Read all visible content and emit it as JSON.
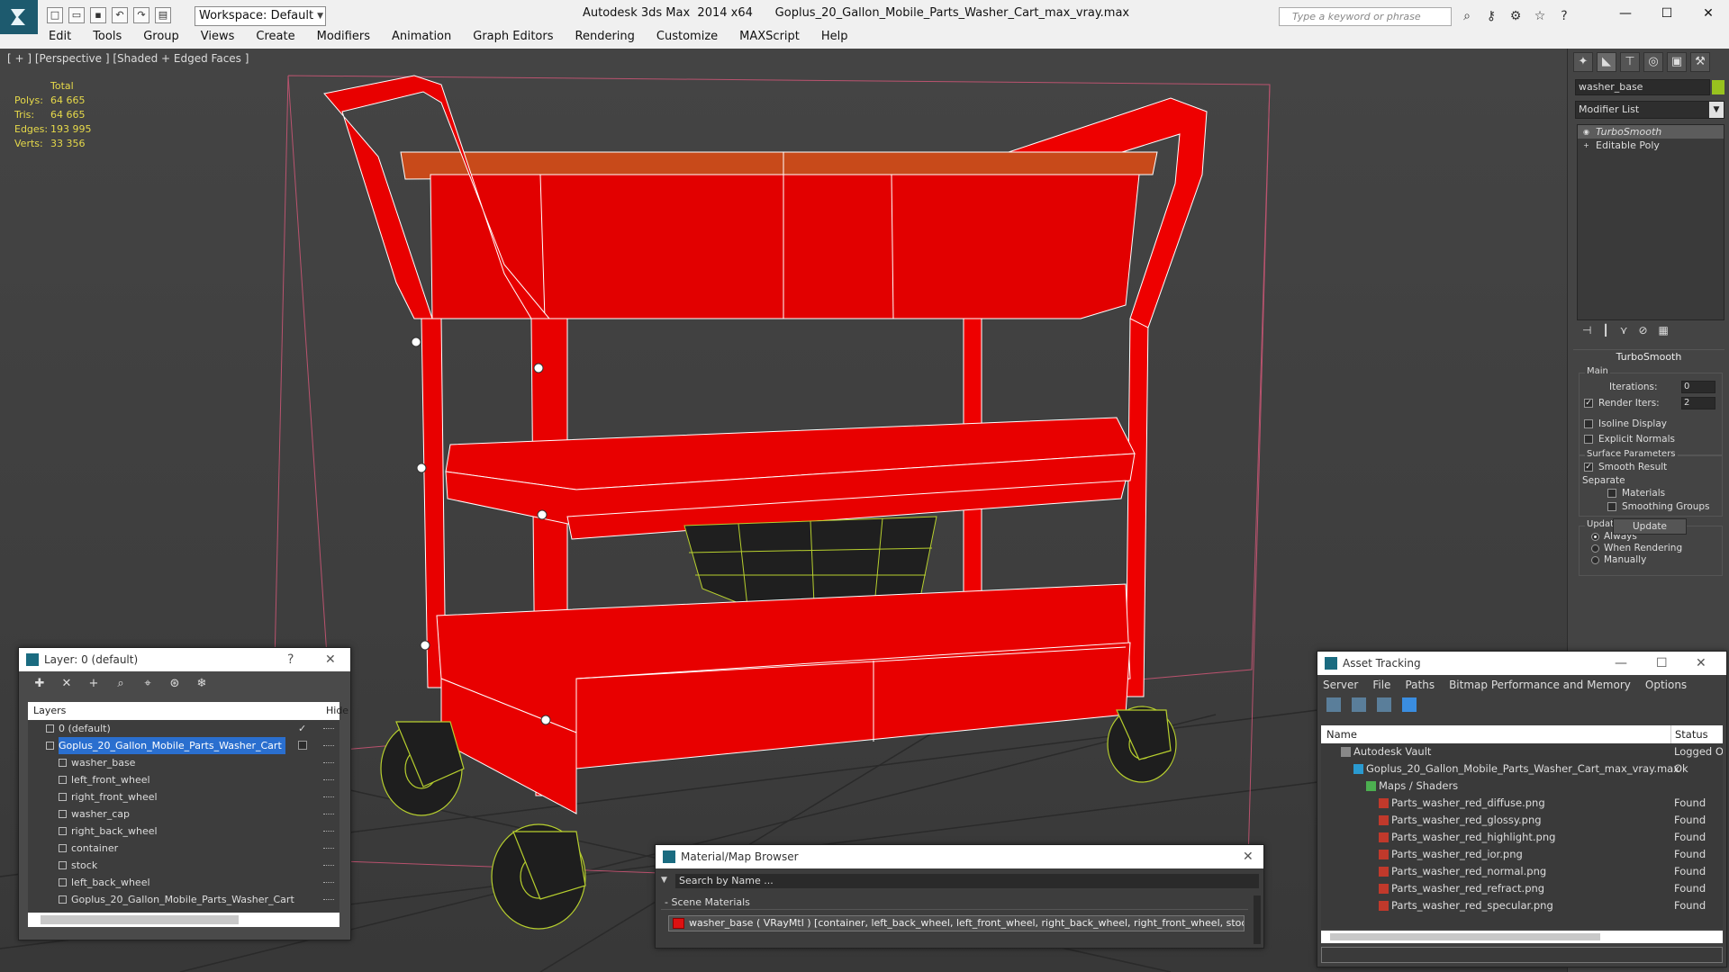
{
  "app": {
    "title": "Autodesk 3ds Max  2014 x64      Goplus_20_Gallon_Mobile_Parts_Washer_Cart_max_vray.max",
    "workspace": "Workspace: Default",
    "search_placeholder": "Type a keyword or phrase"
  },
  "menu": [
    "Edit",
    "Tools",
    "Group",
    "Views",
    "Create",
    "Modifiers",
    "Animation",
    "Graph Editors",
    "Rendering",
    "Customize",
    "MAXScript",
    "Help"
  ],
  "viewport": {
    "label": "[ + ] [Perspective ] [Shaded + Edged Faces ]",
    "stats_header": "Total",
    "stats": [
      {
        "label": "Polys:",
        "value": "64 665"
      },
      {
        "label": "Tris:",
        "value": "64 665"
      },
      {
        "label": "Edges:",
        "value": "193 995"
      },
      {
        "label": "Verts:",
        "value": "33 356"
      }
    ]
  },
  "command_panel": {
    "object_name": "washer_base",
    "object_color": "#98c21f",
    "modifier_list": "Modifier List",
    "stack": [
      "TurboSmooth",
      "Editable Poly"
    ],
    "rollout_title": "TurboSmooth",
    "main_group": "Main",
    "iterations_label": "Iterations:",
    "iterations_value": "0",
    "render_iters_label": "Render Iters:",
    "render_iters_value": "2",
    "isoline_display": "Isoline Display",
    "explicit_normals": "Explicit Normals",
    "surface_parameters": "Surface Parameters",
    "smooth_result": "Smooth Result",
    "separate": "Separate",
    "materials": "Materials",
    "smoothing_groups": "Smoothing Groups",
    "update_options": "Update Options",
    "always": "Always",
    "when_rendering": "When Rendering",
    "manually": "Manually",
    "update_button": "Update"
  },
  "layer_explorer": {
    "title": "Layer: 0 (default)",
    "help": "?",
    "close": "✕",
    "col_layers": "Layers",
    "col_hide": "Hide",
    "rows": [
      {
        "name": "0 (default)",
        "level": 0
      },
      {
        "name": "Goplus_20_Gallon_Mobile_Parts_Washer_Cart",
        "level": 0
      },
      {
        "name": "washer_base",
        "level": 1
      },
      {
        "name": "left_front_wheel",
        "level": 1
      },
      {
        "name": "right_front_wheel",
        "level": 1
      },
      {
        "name": "washer_cap",
        "level": 1
      },
      {
        "name": "right_back_wheel",
        "level": 1
      },
      {
        "name": "container",
        "level": 1
      },
      {
        "name": "stock",
        "level": 1
      },
      {
        "name": "left_back_wheel",
        "level": 1
      },
      {
        "name": "Goplus_20_Gallon_Mobile_Parts_Washer_Cart",
        "level": 1
      }
    ]
  },
  "asset_tracking": {
    "title": "Asset Tracking",
    "menu": [
      "Server",
      "File",
      "Paths",
      "Bitmap Performance and Memory",
      "Options"
    ],
    "col_name": "Name",
    "col_status": "Status",
    "rows": [
      {
        "name": "Autodesk Vault",
        "status": "Logged O",
        "level": 0
      },
      {
        "name": "Goplus_20_Gallon_Mobile_Parts_Washer_Cart_max_vray.max",
        "status": "Ok",
        "level": 1
      },
      {
        "name": "Maps / Shaders",
        "status": "",
        "level": 2
      },
      {
        "name": "Parts_washer_red_diffuse.png",
        "status": "Found",
        "level": 3
      },
      {
        "name": "Parts_washer_red_glossy.png",
        "status": "Found",
        "level": 3
      },
      {
        "name": "Parts_washer_red_highlight.png",
        "status": "Found",
        "level": 3
      },
      {
        "name": "Parts_washer_red_ior.png",
        "status": "Found",
        "level": 3
      },
      {
        "name": "Parts_washer_red_normal.png",
        "status": "Found",
        "level": 3
      },
      {
        "name": "Parts_washer_red_refract.png",
        "status": "Found",
        "level": 3
      },
      {
        "name": "Parts_washer_red_specular.png",
        "status": "Found",
        "level": 3
      }
    ]
  },
  "material_browser": {
    "title": "Material/Map Browser",
    "search": "Search by Name ...",
    "section": "- Scene Materials",
    "material": "washer_base ( VRayMtl ) [container, left_back_wheel, left_front_wheel, right_back_wheel, right_front_wheel, stock, wa..."
  }
}
